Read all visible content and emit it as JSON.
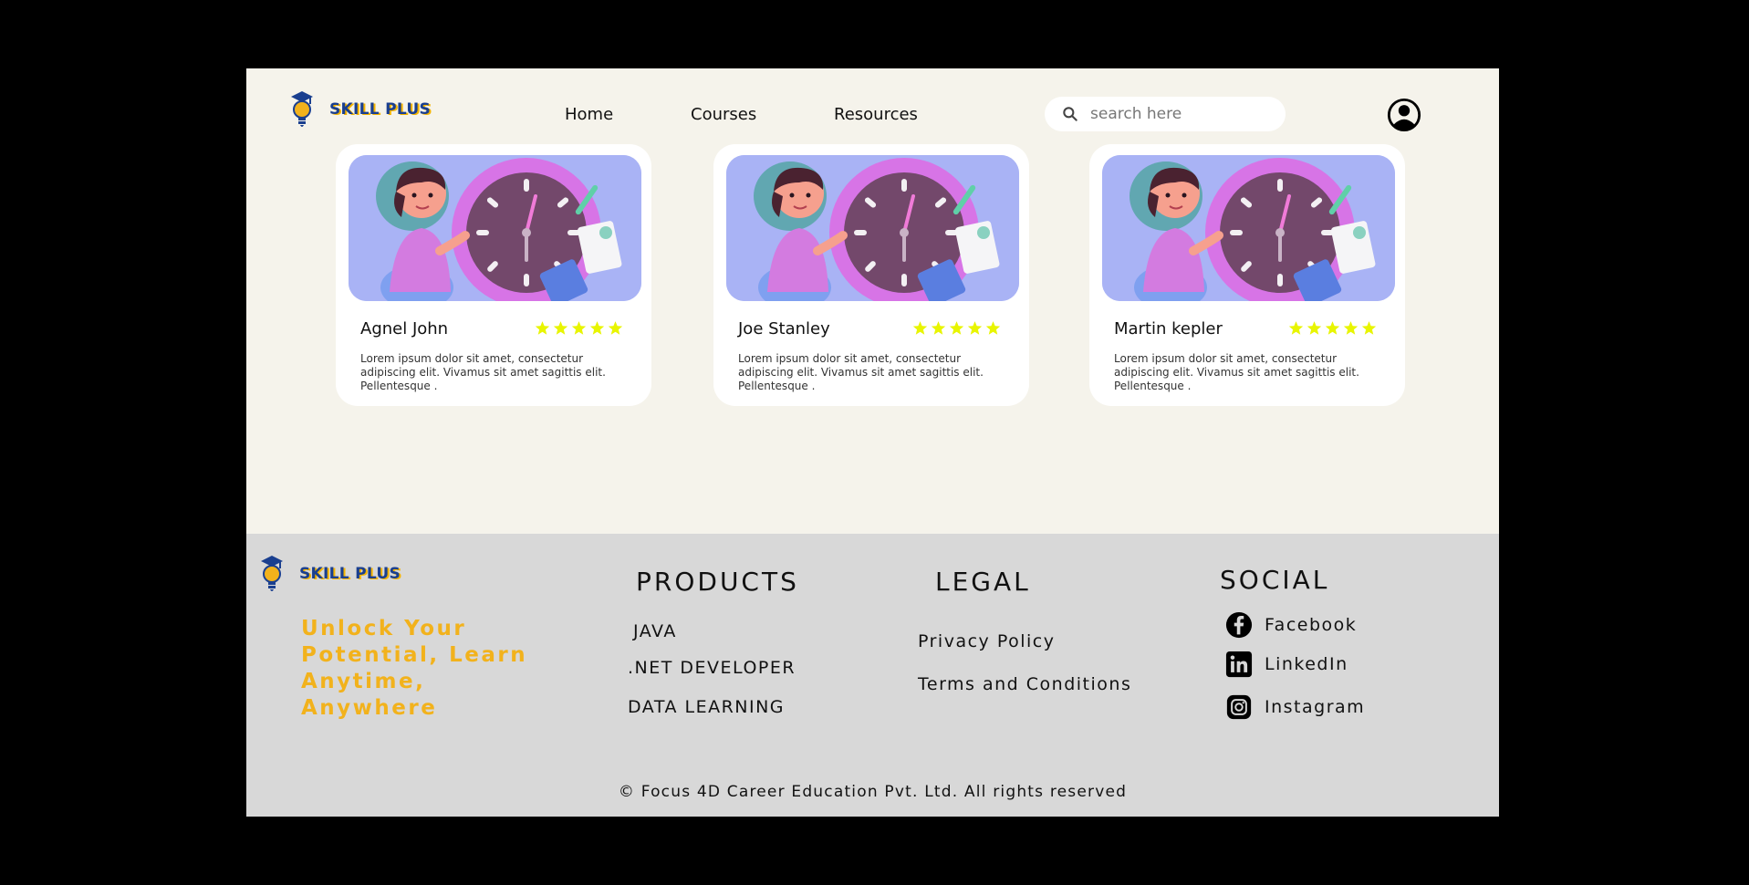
{
  "header": {
    "brand": "SKILL PLUS",
    "nav": [
      "Home",
      "Courses",
      "Resources"
    ],
    "search_placeholder": "search here"
  },
  "cards": [
    {
      "name": "Agnel John",
      "rating": 5,
      "description": "Lorem ipsum dolor sit amet, consectetur adipiscing elit. Vivamus sit amet sagittis elit. Pellentesque ."
    },
    {
      "name": "Joe Stanley",
      "rating": 5,
      "description": "Lorem ipsum dolor sit amet, consectetur adipiscing elit. Vivamus sit amet sagittis elit. Pellentesque ."
    },
    {
      "name": "Martin kepler",
      "rating": 5,
      "description": "Lorem ipsum dolor sit amet, consectetur adipiscing elit. Vivamus sit amet sagittis elit. Pellentesque ."
    }
  ],
  "footer": {
    "brand": "SKILL PLUS",
    "tagline": "Unlock Your Potential, Learn Anytime, Anywhere",
    "products": {
      "heading": "PRODUCTS",
      "items": [
        "JAVA",
        ".NET DEVELOPER",
        "DATA LEARNING"
      ]
    },
    "legal": {
      "heading": "LEGAL",
      "items": [
        "Privacy Policy",
        "Terms and Conditions"
      ]
    },
    "social": {
      "heading": "SOCIAL",
      "items": [
        {
          "label": "Facebook",
          "icon": "facebook-icon"
        },
        {
          "label": "LinkedIn",
          "icon": "linkedin-icon"
        },
        {
          "label": "Instagram",
          "icon": "instagram-icon"
        }
      ]
    },
    "copyright": "© Focus 4D Career Education Pvt. Ltd. All rights reserved"
  },
  "colors": {
    "page_background": "#f5f3eb",
    "footer_background": "#d8d8d8",
    "accent_yellow": "#f2b21c",
    "star": "#e8f500",
    "brand_blue": "#1a3f8f",
    "thumb_background": "#a9b3f5"
  }
}
